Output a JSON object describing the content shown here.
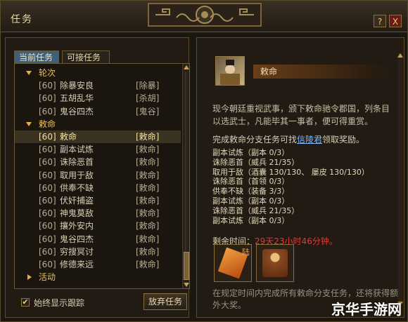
{
  "window": {
    "title": "任务",
    "help_label": "?",
    "close_label": "X"
  },
  "tabs": {
    "current": "当前任务",
    "available": "可接任务"
  },
  "quest_list": [
    {
      "type": "group",
      "label": "轮次",
      "expanded": true
    },
    {
      "type": "item",
      "level": "[60]",
      "name": "除暴安良",
      "category": "[除暴]"
    },
    {
      "type": "item",
      "level": "[60]",
      "name": "五胡乱华",
      "category": "[杀胡]"
    },
    {
      "type": "item",
      "level": "[60]",
      "name": "鬼谷四杰",
      "category": "[鬼谷]"
    },
    {
      "type": "group",
      "label": "敕命",
      "expanded": true
    },
    {
      "type": "item",
      "level": "[60]",
      "name": "敕命",
      "category": "[敕命]",
      "selected": true
    },
    {
      "type": "item",
      "level": "[60]",
      "name": "副本试炼",
      "category": "[敕命]"
    },
    {
      "type": "item",
      "level": "[60]",
      "name": "诛除恶首",
      "category": "[敕命]"
    },
    {
      "type": "item",
      "level": "[60]",
      "name": "取用于敌",
      "category": "[敕命]"
    },
    {
      "type": "item",
      "level": "[60]",
      "name": "供奉不缺",
      "category": "[敕命]"
    },
    {
      "type": "item",
      "level": "[60]",
      "name": "伏奸捕盗",
      "category": "[敕命]"
    },
    {
      "type": "item",
      "level": "[60]",
      "name": "神鬼莫敌",
      "category": "[敕命]"
    },
    {
      "type": "item",
      "level": "[60]",
      "name": "攘外安内",
      "category": "[敕命]"
    },
    {
      "type": "item",
      "level": "[60]",
      "name": "鬼谷四杰",
      "category": "[敕命]"
    },
    {
      "type": "item",
      "level": "[60]",
      "name": "穷搜冥讨",
      "category": "[敕命]"
    },
    {
      "type": "item",
      "level": "[60]",
      "name": "修德来远",
      "category": "[敕命]"
    },
    {
      "type": "group",
      "label": "活动",
      "expanded": false
    }
  ],
  "always_track_label": "始终显示跟踪",
  "always_track_checked": true,
  "abandon_label": "放弃任务",
  "detail": {
    "title": "敕命",
    "description": "现今朝廷重视武事，颁下敕命驰令郡国，列条目以选武士，凡能毕其一事者，便可得重赏。",
    "reward_prefix": "完成敕命分支任务可找",
    "reward_npc": "信陵君",
    "reward_suffix": "领取奖励。",
    "objectives": [
      "副本试炼（副本 0/3）",
      "诛除恶首（威兵 21/35）",
      "取用于敌（酒囊 130/130、 屡皮 130/130）",
      "诛除恶首（首领 0/3）",
      "供奉不缺（装备 3/3）",
      "副本试炼（副本 0/3）",
      "诛除恶首（威兵 21/35）",
      "副本试炼（副本 0/3）"
    ],
    "remaining_label": "剩余时间：",
    "remaining_time": "29天23小时46分钟。",
    "reward_item_tag": "陆",
    "footer": "在规定时间内完成所有敕命分支任务，还将获得额外大奖。"
  },
  "watermark": "京华手游网"
}
